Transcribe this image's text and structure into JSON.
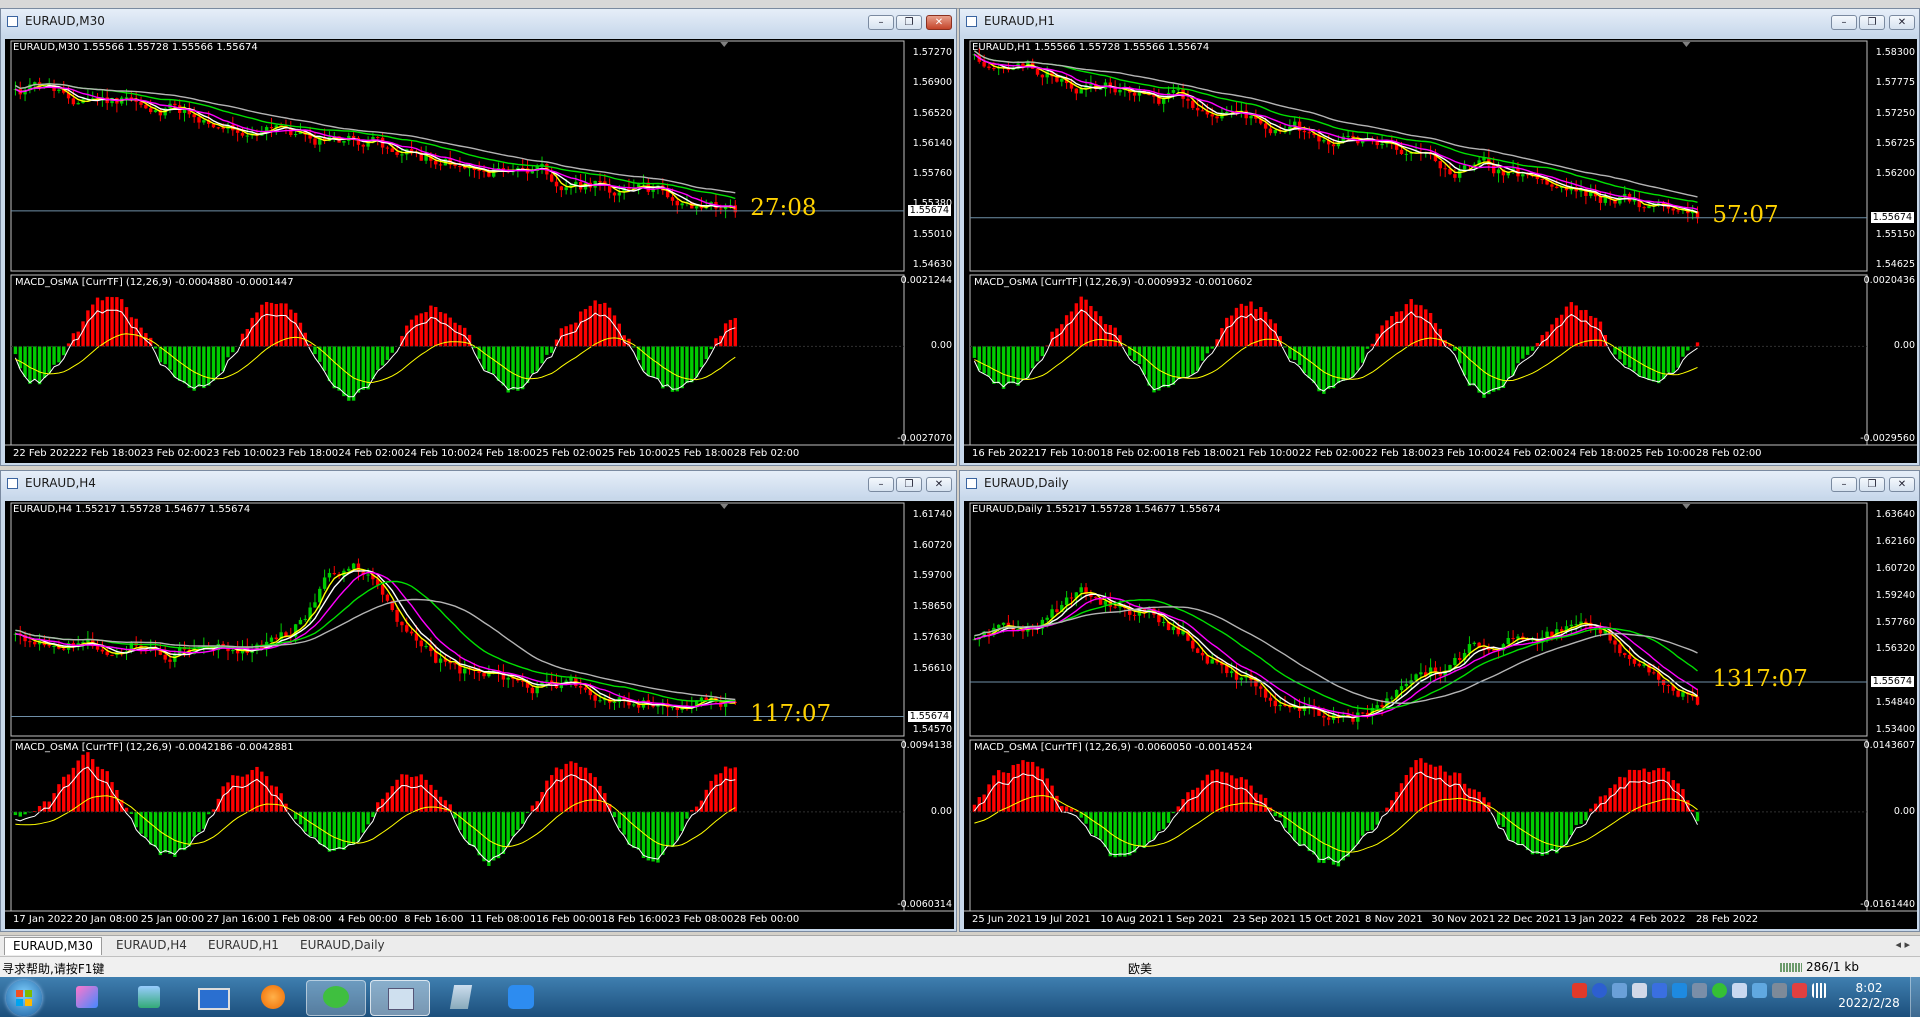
{
  "windows": [
    {
      "id": "m30",
      "title": "EURAUD,M30",
      "info": "EURAUD,M30  1.55566 1.55728 1.55566 1.55674",
      "prices": [
        "1.57270",
        "1.56900",
        "1.56520",
        "1.56140",
        "1.55760",
        "1.55380",
        "1.55010",
        "1.54630"
      ],
      "current": "1.55674",
      "timer": "27:08",
      "macd_label": "MACD_OsMA [CurrTF] (12,26,9) -0.0004880 -0.0001447",
      "macd_top": "0.0021244",
      "macd_mid": "0.00",
      "macd_bottom": "-0.0027070",
      "dates": [
        "22 Feb 2022",
        "22 Feb 18:00",
        "23 Feb 02:00",
        "23 Feb 10:00",
        "23 Feb 18:00",
        "24 Feb 02:00",
        "24 Feb 10:00",
        "24 Feb 18:00",
        "25 Feb 02:00",
        "25 Feb 10:00",
        "25 Feb 18:00",
        "28 Feb 02:00"
      ]
    },
    {
      "id": "h1",
      "title": "EURAUD,H1",
      "info": "EURAUD,H1  1.55566 1.55728 1.55566 1.55674",
      "prices": [
        "1.58300",
        "1.57775",
        "1.57250",
        "1.56725",
        "1.56200",
        "1.55674",
        "1.55150",
        "1.54625"
      ],
      "current": "1.55674",
      "timer": "57:07",
      "macd_label": "MACD_OsMA [CurrTF] (12,26,9) -0.0009932 -0.0010602",
      "macd_top": "0.0020436",
      "macd_mid": "0.00",
      "macd_bottom": "-0.0029560",
      "dates": [
        "16 Feb 2022",
        "17 Feb 10:00",
        "18 Feb 02:00",
        "18 Feb 18:00",
        "21 Feb 10:00",
        "22 Feb 02:00",
        "22 Feb 18:00",
        "23 Feb 10:00",
        "24 Feb 02:00",
        "24 Feb 18:00",
        "25 Feb 10:00",
        "28 Feb 02:00"
      ]
    },
    {
      "id": "h4",
      "title": "EURAUD,H4",
      "info": "EURAUD,H4  1.55217 1.55728 1.54677 1.55674",
      "prices": [
        "1.61740",
        "1.60720",
        "1.59700",
        "1.58650",
        "1.57630",
        "1.56610",
        "1.55674",
        "1.54570"
      ],
      "current": "1.55674",
      "timer": "117:07",
      "macd_label": "MACD_OsMA [CurrTF] (12,26,9) -0.0042186 -0.0042881",
      "macd_top": "0.0094138",
      "macd_mid": "0.00",
      "macd_bottom": "-0.0060314",
      "dates": [
        "17 Jan 2022",
        "20 Jan 08:00",
        "25 Jan 00:00",
        "27 Jan 16:00",
        "1 Feb 08:00",
        "4 Feb 00:00",
        "8 Feb 16:00",
        "11 Feb 08:00",
        "16 Feb 00:00",
        "18 Feb 16:00",
        "23 Feb 08:00",
        "28 Feb 00:00"
      ]
    },
    {
      "id": "d1",
      "title": "EURAUD,Daily",
      "info": "EURAUD,Daily  1.55217 1.55728 1.54677 1.55674",
      "prices": [
        "1.63640",
        "1.62160",
        "1.60720",
        "1.59240",
        "1.57760",
        "1.56320",
        "1.55674",
        "1.54840",
        "1.53400"
      ],
      "current": "1.55674",
      "timer": "1317:07",
      "macd_label": "MACD_OsMA [CurrTF] (12,26,9) -0.0060050 -0.0014524",
      "macd_top": "0.0143607",
      "macd_mid": "0.00",
      "macd_bottom": "-0.0161440",
      "dates": [
        "25 Jun 2021",
        "19 Jul 2021",
        "10 Aug 2021",
        "1 Sep 2021",
        "23 Sep 2021",
        "15 Oct 2021",
        "8 Nov 2021",
        "30 Nov 2021",
        "22 Dec 2021",
        "13 Jan 2022",
        "4 Feb 2022",
        "28 Feb 2022"
      ]
    }
  ],
  "tabs": [
    "EURAUD,M30",
    "EURAUD,H4",
    "EURAUD,H1",
    "EURAUD,Daily"
  ],
  "status": {
    "help": "寻求帮助,请按F1键",
    "profile": "欧美",
    "traffic": "286/1 kb"
  },
  "clock": {
    "time": "8:02",
    "date": "2022/2/28"
  },
  "colors": {
    "bull": "#00cc00",
    "bear": "#ff0000",
    "ma_yellow": "#ffff00",
    "ma_white": "#ffffff",
    "ma_magenta": "#ff00ff",
    "ma_green": "#00e000",
    "ma_gray": "#b4b4b4",
    "timer": "#ffd200"
  }
}
